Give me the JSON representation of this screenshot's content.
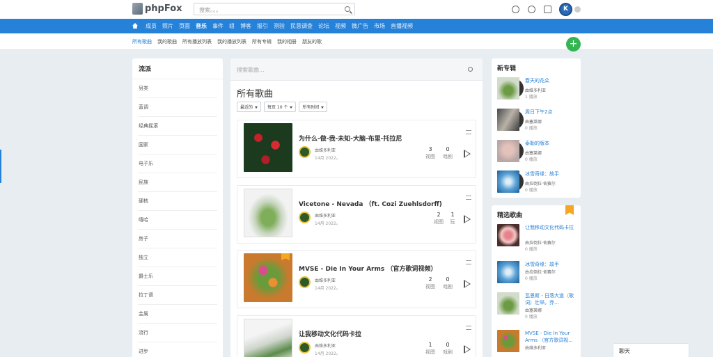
{
  "header": {
    "logo_text": "phpFox",
    "search_placeholder": "搜索。。。"
  },
  "nav": {
    "items": [
      "成员",
      "照片",
      "页面",
      "音乐",
      "事件",
      "组",
      "博客",
      "报引",
      "测验",
      "民意调查",
      "论坛",
      "视频",
      "微广告",
      "市场",
      "直播视频"
    ],
    "active": "音乐"
  },
  "subnav": {
    "items": [
      "所有歌曲",
      "我的歌曲",
      "所有播放列表",
      "我的播放列表",
      "所有专辑",
      "我的相册",
      "朋友的歌"
    ],
    "active": "所有歌曲"
  },
  "genres": {
    "title": "流派",
    "items": [
      "另类",
      "蓝调",
      "经典摇滚",
      "国家",
      "电子乐",
      "民族",
      "硬核",
      "嘻哈",
      "房子",
      "独立",
      "爵士乐",
      "拉丁语",
      "金属",
      "流行",
      "进步"
    ]
  },
  "main": {
    "search_placeholder": "搜索歌曲...",
    "title": "所有歌曲",
    "filters": [
      "最近的",
      "每页 10 个",
      "所有时间"
    ],
    "songs": [
      {
        "title": "为什么-做-我-未知-大脑-布里-托拉尼",
        "by": "由维多利亚",
        "date": "14月 2022。",
        "views": "3",
        "views_label": "视图",
        "plays": "0",
        "plays_label": "戏剧",
        "featured": false
      },
      {
        "title": "Vicetone - Nevada （ft. Cozi Zuehlsdorff)",
        "by": "由维多利亚",
        "date": "14月 2022。",
        "views": "2",
        "views_label": "视图",
        "plays": "1",
        "plays_label": "玩",
        "featured": false
      },
      {
        "title": "MVSE - Die In Your Arms （官方歌词视频）",
        "by": "由维多利亚",
        "date": "14月 2022。",
        "views": "2",
        "views_label": "视图",
        "plays": "0",
        "plays_label": "戏剧",
        "featured": true
      },
      {
        "title": "让我移动文化代码卡拉",
        "by": "由维多利亚",
        "date": "14月 2022。",
        "views": "1",
        "views_label": "视图",
        "plays": "0",
        "plays_label": "戏剧",
        "featured": false
      }
    ]
  },
  "new_albums": {
    "title": "新专辑",
    "items": [
      {
        "title": "春天的花朵",
        "by": "由维多利亚",
        "plays": "1 播放"
      },
      {
        "title": "周日下午2点",
        "by": "由塞莱娜",
        "plays": "0 播放"
      },
      {
        "title": "泰勒的版本",
        "by": "由塞莱娜",
        "plays": "0 播放"
      },
      {
        "title": "冰雪奇缘：故手",
        "by": "由拉倒拉·舍赛尔",
        "plays": "0 播放"
      }
    ]
  },
  "featured_songs": {
    "title": "精选歌曲",
    "items": [
      {
        "title": "让我移动文化代码卡拉",
        "by": "由拉倒拉·舍赛尔",
        "plays": "0 播放"
      },
      {
        "title": "冰雪奇缘：故手",
        "by": "由拉倒拉·舍赛尔",
        "plays": "0 播放"
      },
      {
        "title": "瓦恩斯 - 日落大道（歌词）壮举。乔...",
        "by": "由塞莱娜",
        "plays": "0 播放"
      },
      {
        "title": "MVSE - Die In Your Arms （官方歌词视...",
        "by": "由维多利亚",
        "plays": "0 播放"
      }
    ]
  },
  "chat": {
    "label": "聊天"
  },
  "avatar_letter": "K",
  "colors": {
    "primary": "#2681d8",
    "fab": "#33b552",
    "badge": "#f5a623"
  }
}
